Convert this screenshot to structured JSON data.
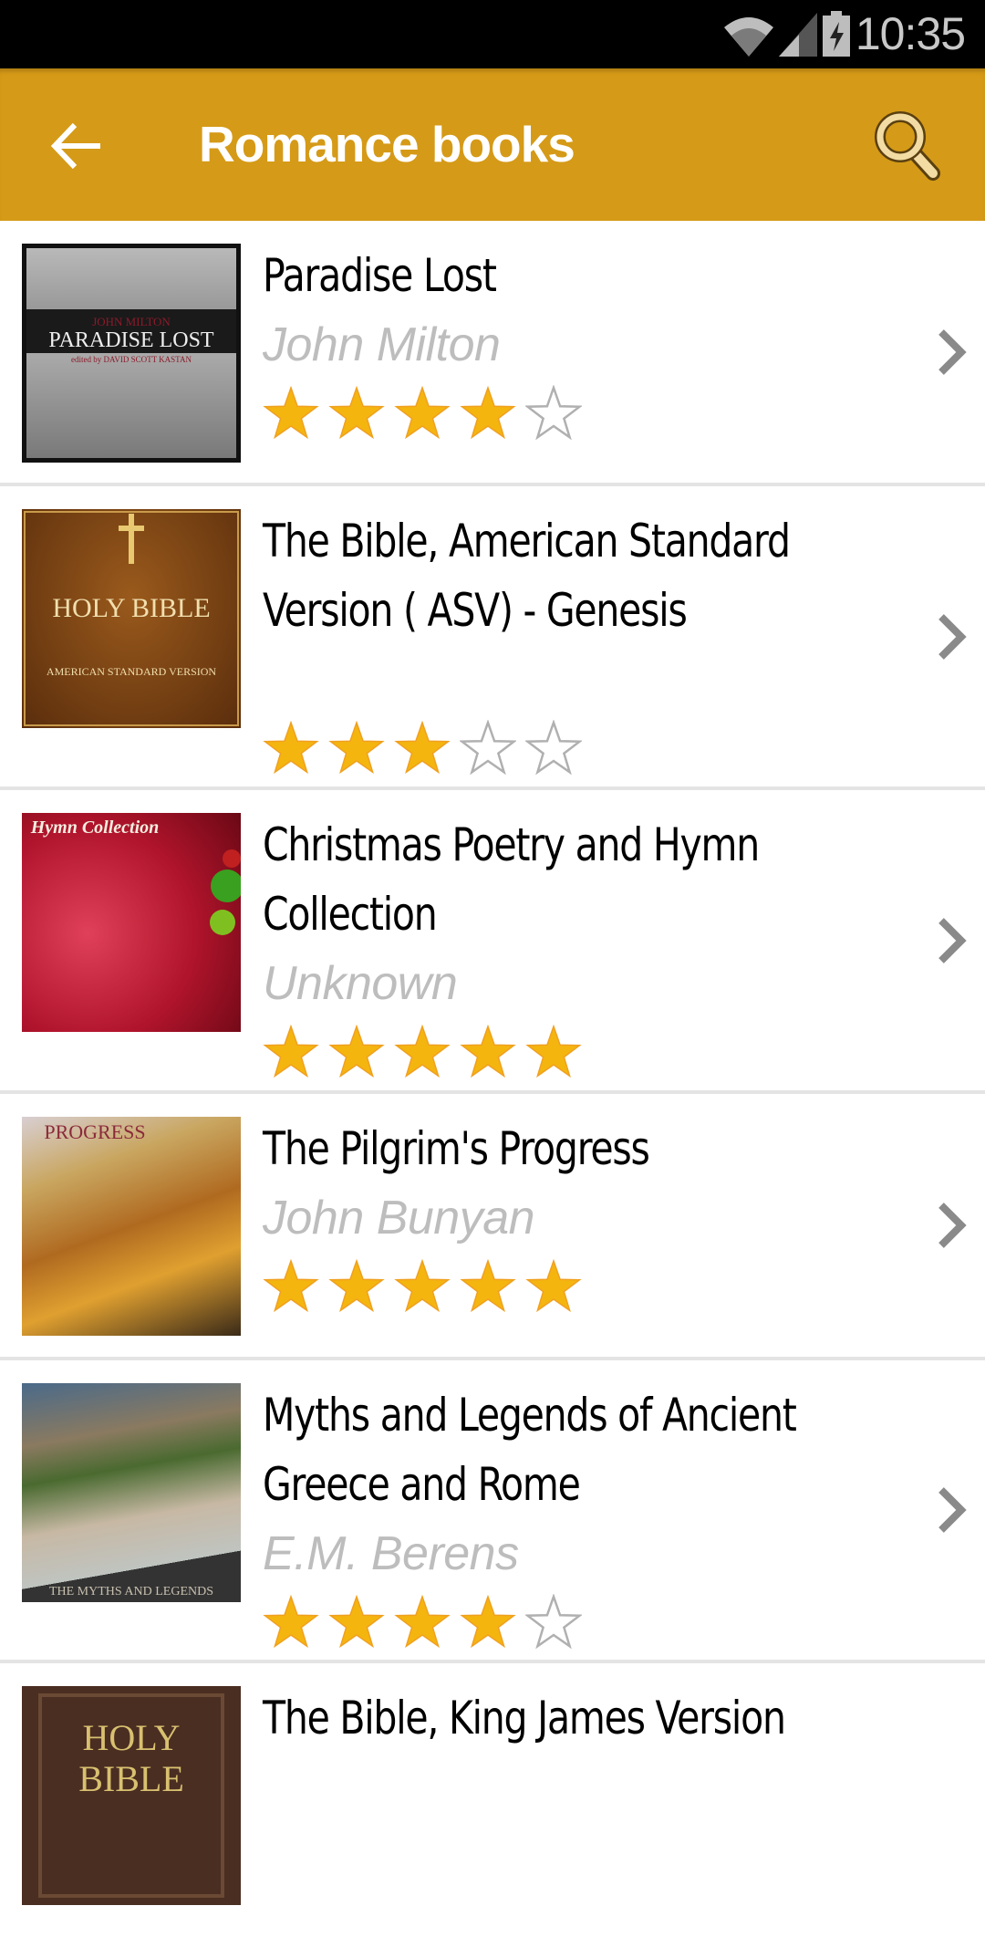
{
  "status_bar": {
    "time": "10:35",
    "icons": [
      "wifi-icon",
      "cell-signal-icon",
      "battery-charging-icon"
    ]
  },
  "action_bar": {
    "title": "Romance books",
    "back_icon": "arrow-left-icon",
    "search_icon": "search-icon"
  },
  "colors": {
    "accent": "#D59A17",
    "star_filled": "#F5B50F",
    "star_empty_stroke": "#B0B0B0",
    "author_text": "#BDBDBD",
    "divider": "#E4E4E4"
  },
  "books": [
    {
      "title": "Paradise Lost",
      "author": "John Milton",
      "rating": 4,
      "max_rating": 5,
      "cover": "paradise-lost-cover"
    },
    {
      "title": "The Bible, American Standard Version (ASV) - Genesis",
      "author": "",
      "rating": 3,
      "max_rating": 5,
      "cover": "holy-bible-asv-cover"
    },
    {
      "title": "Christmas Poetry and Hymn Collection",
      "author": "Unknown",
      "rating": 5,
      "max_rating": 5,
      "cover": "hymn-collection-cover"
    },
    {
      "title": "The Pilgrim's Progress",
      "author": "John Bunyan",
      "rating": 5,
      "max_rating": 5,
      "cover": "pilgrims-progress-cover"
    },
    {
      "title": "Myths and Legends of Ancient Greece and Rome",
      "author": "E.M. Berens",
      "rating": 4,
      "max_rating": 5,
      "cover": "myths-legends-cover"
    },
    {
      "title": "The Bible, King James Version",
      "author": "",
      "rating": null,
      "max_rating": 5,
      "cover": "holy-bible-kjv-cover"
    }
  ],
  "title_lines": [
    [
      "Paradise Lost"
    ],
    [
      "The Bible, American Standard",
      "Version ( ASV)  - Genesis"
    ],
    [
      "Christmas Poetry and Hymn",
      "Collection"
    ],
    [
      "The Pilgrim's Progress"
    ],
    [
      "Myths and Legends of Ancient",
      "Greece and Rome"
    ],
    [
      "The Bible, King James Version"
    ]
  ],
  "cover_texts": {
    "paradise_lost": [
      "JOHN MILTON",
      "PARADISE LOST",
      "edited by DAVID SCOTT KASTAN"
    ],
    "asv": [
      "HOLY BIBLE",
      "AMERICAN STANDARD VERSION"
    ],
    "hymn": [
      "Hymn Collection"
    ],
    "pilgrim": [
      "PROGRESS"
    ],
    "myths": [
      "THE MYTHS AND LEGENDS"
    ],
    "kjv": [
      "HOLY",
      "BIBLE"
    ]
  }
}
